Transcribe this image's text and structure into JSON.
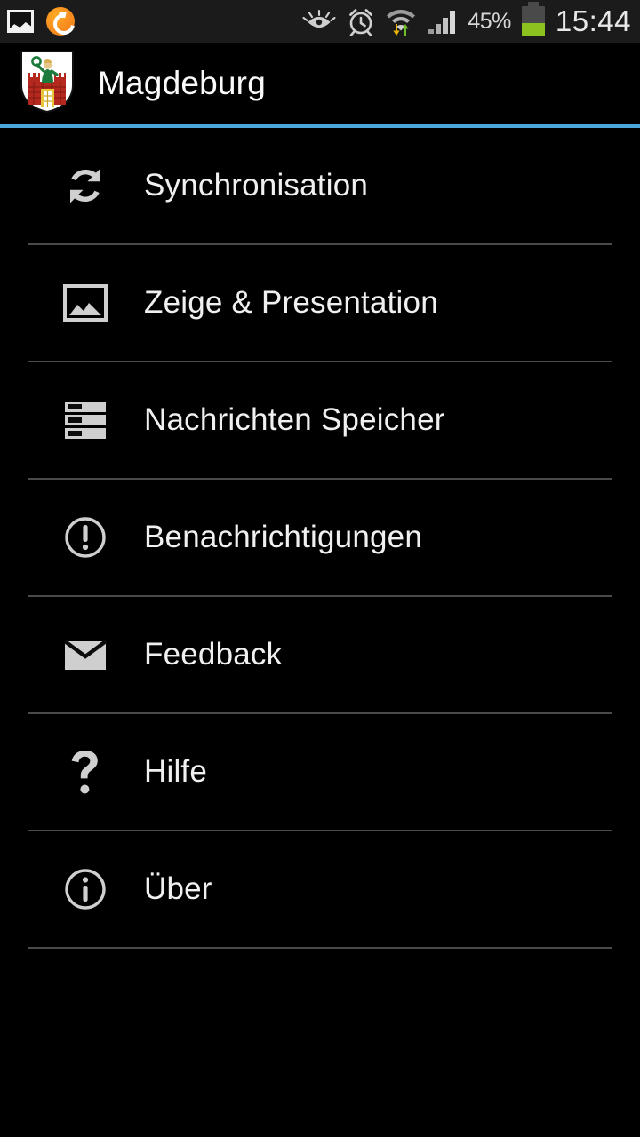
{
  "status_bar": {
    "left_icons": [
      {
        "name": "gallery-notification-icon",
        "glyph": "image"
      },
      {
        "name": "app-sync-notification-icon",
        "glyph": "orange-circle-arrow"
      }
    ],
    "right_icons": [
      {
        "name": "smart-stay-eye-icon",
        "glyph": "eye"
      },
      {
        "name": "alarm-clock-icon",
        "glyph": "alarm"
      },
      {
        "name": "wifi-data-transfer-icon",
        "glyph": "wifi-arrows"
      },
      {
        "name": "cellular-signal-icon",
        "glyph": "signal-bars"
      }
    ],
    "battery_percent": "45%",
    "battery_level": 45,
    "clock": "15:44",
    "background_color": "#1b1b1b"
  },
  "action_bar": {
    "title": "Magdeburg",
    "logo_name": "magdeburg-coat-of-arms",
    "accent_color": "#4ca6d9"
  },
  "menu": {
    "items": [
      {
        "id": "synchronisation",
        "label": "Synchronisation",
        "icon": "sync-icon"
      },
      {
        "id": "zeige-presentation",
        "label": "Zeige & Presentation",
        "icon": "image-icon"
      },
      {
        "id": "nachrichten-speicher",
        "label": "Nachrichten Speicher",
        "icon": "message-storage-list-icon"
      },
      {
        "id": "benachrichtigungen",
        "label": "Benachrichtigungen",
        "icon": "exclamation-circle-icon"
      },
      {
        "id": "feedback",
        "label": "Feedback",
        "icon": "envelope-icon"
      },
      {
        "id": "hilfe",
        "label": "Hilfe",
        "icon": "question-mark-icon"
      },
      {
        "id": "ueber",
        "label": "Über",
        "icon": "info-circle-icon"
      }
    ]
  },
  "colors": {
    "background": "#000000",
    "text": "#f0f0f0",
    "divider": "#4a4a4a",
    "icon": "#cfcfcf",
    "accent": "#4ca6d9",
    "battery_green": "#8bc220"
  }
}
